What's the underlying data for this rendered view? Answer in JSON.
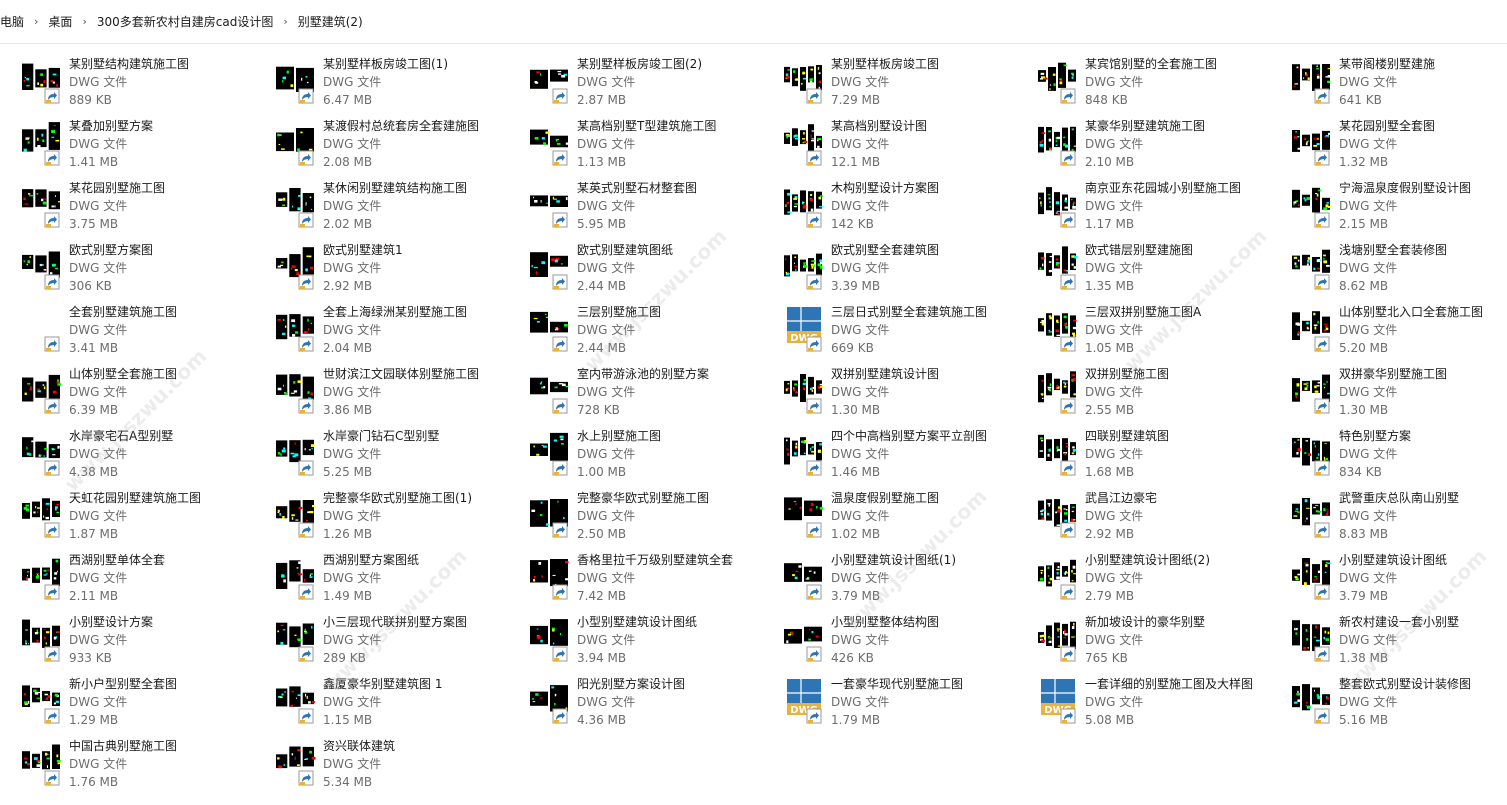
{
  "breadcrumb": [
    "电脑",
    "桌面",
    "300多套新农村自建房cad设计图",
    "别墅建筑(2)"
  ],
  "icons": {
    "separator": "chevron-right-icon",
    "shortcut": "shortcut-arrow-icon",
    "dwg_logo": "dwg-file-icon",
    "thumbnail": "cad-thumbnail-icon"
  },
  "colors": {
    "cad_black": "#000000",
    "cad_green": "#00ff00",
    "cad_cyan": "#00ffff",
    "cad_red": "#ff0000",
    "dwg_blue": "#2e75b6",
    "dwg_gold": "#e8b33a"
  },
  "watermark_text": "www.jsszwu.com",
  "files": [
    {
      "name": "某别墅结构建筑施工图",
      "type": "DWG 文件",
      "size": "889 KB",
      "thumb": "cad"
    },
    {
      "name": "某别墅样板房竣工图(1)",
      "type": "DWG 文件",
      "size": "6.47 MB",
      "thumb": "cad"
    },
    {
      "name": "某别墅样板房竣工图(2)",
      "type": "DWG 文件",
      "size": "2.87 MB",
      "thumb": "cad"
    },
    {
      "name": "某别墅样板房竣工图",
      "type": "DWG 文件",
      "size": "7.29 MB",
      "thumb": "cad"
    },
    {
      "name": "某宾馆别墅的全套施工图",
      "type": "DWG 文件",
      "size": "848 KB",
      "thumb": "cad"
    },
    {
      "name": "某带阁楼别墅建施",
      "type": "DWG 文件",
      "size": "641 KB",
      "thumb": "cad"
    },
    {
      "name": "某叠加别墅方案",
      "type": "DWG 文件",
      "size": "1.41 MB",
      "thumb": "cad"
    },
    {
      "name": "某渡假村总统套房全套建施图",
      "type": "DWG 文件",
      "size": "2.08 MB",
      "thumb": "cad"
    },
    {
      "name": "某高档别墅T型建筑施工图",
      "type": "DWG 文件",
      "size": "1.13 MB",
      "thumb": "cad"
    },
    {
      "name": "某高档别墅设计图",
      "type": "DWG 文件",
      "size": "12.1 MB",
      "thumb": "cad"
    },
    {
      "name": "某豪华别墅建筑施工图",
      "type": "DWG 文件",
      "size": "2.10 MB",
      "thumb": "cad"
    },
    {
      "name": "某花园别墅全套图",
      "type": "DWG 文件",
      "size": "1.32 MB",
      "thumb": "cad"
    },
    {
      "name": "某花园别墅施工图",
      "type": "DWG 文件",
      "size": "3.75 MB",
      "thumb": "cad"
    },
    {
      "name": "某休闲别墅建筑结构施工图",
      "type": "DWG 文件",
      "size": "2.02 MB",
      "thumb": "cad"
    },
    {
      "name": "某英式别墅石材整套图",
      "type": "DWG 文件",
      "size": "5.95 MB",
      "thumb": "cad"
    },
    {
      "name": "木构别墅设计方案图",
      "type": "DWG 文件",
      "size": "142 KB",
      "thumb": "cad"
    },
    {
      "name": "南京亚东花园城小别墅施工图",
      "type": "DWG 文件",
      "size": "1.17 MB",
      "thumb": "cad"
    },
    {
      "name": "宁海温泉度假别墅设计图",
      "type": "DWG 文件",
      "size": "2.15 MB",
      "thumb": "cad"
    },
    {
      "name": "欧式别墅方案图",
      "type": "DWG 文件",
      "size": "306 KB",
      "thumb": "cad"
    },
    {
      "name": "欧式别墅建筑1",
      "type": "DWG 文件",
      "size": "2.92 MB",
      "thumb": "cad"
    },
    {
      "name": "欧式别墅建筑图纸",
      "type": "DWG 文件",
      "size": "2.44 MB",
      "thumb": "cad"
    },
    {
      "name": "欧式别墅全套建筑图",
      "type": "DWG 文件",
      "size": "3.39 MB",
      "thumb": "cad"
    },
    {
      "name": "欧式错层别墅建施图",
      "type": "DWG 文件",
      "size": "1.35 MB",
      "thumb": "cad"
    },
    {
      "name": "浅塘别墅全套装修图",
      "type": "DWG 文件",
      "size": "8.62 MB",
      "thumb": "cad"
    },
    {
      "name": "全套别墅建筑施工图",
      "type": "DWG 文件",
      "size": "3.41 MB",
      "thumb": "none"
    },
    {
      "name": "全套上海绿洲某别墅施工图",
      "type": "DWG 文件",
      "size": "2.04 MB",
      "thumb": "cad"
    },
    {
      "name": "三层别墅施工图",
      "type": "DWG 文件",
      "size": "2.44 MB",
      "thumb": "cad"
    },
    {
      "name": "三层日式别墅全套建筑施工图",
      "type": "DWG 文件",
      "size": "669 KB",
      "thumb": "dwg"
    },
    {
      "name": "三层双拼别墅施工图A",
      "type": "DWG 文件",
      "size": "1.05 MB",
      "thumb": "cad"
    },
    {
      "name": "山体别墅北入口全套施工图",
      "type": "DWG 文件",
      "size": "5.20 MB",
      "thumb": "cad"
    },
    {
      "name": "山体别墅全套施工图",
      "type": "DWG 文件",
      "size": "6.39 MB",
      "thumb": "cad"
    },
    {
      "name": "世财滨江文园联体别墅施工图",
      "type": "DWG 文件",
      "size": "3.86 MB",
      "thumb": "cad"
    },
    {
      "name": "室内带游泳池的别墅方案",
      "type": "DWG 文件",
      "size": "728 KB",
      "thumb": "cad"
    },
    {
      "name": "双拼别墅建筑设计图",
      "type": "DWG 文件",
      "size": "1.30 MB",
      "thumb": "cad"
    },
    {
      "name": "双拼别墅施工图",
      "type": "DWG 文件",
      "size": "2.55 MB",
      "thumb": "cad"
    },
    {
      "name": "双拼豪华别墅施工图",
      "type": "DWG 文件",
      "size": "1.30 MB",
      "thumb": "cad"
    },
    {
      "name": "水岸豪宅石A型别墅",
      "type": "DWG 文件",
      "size": "4.38 MB",
      "thumb": "cad"
    },
    {
      "name": "水岸豪门钻石C型别墅",
      "type": "DWG 文件",
      "size": "5.25 MB",
      "thumb": "cad"
    },
    {
      "name": "水上别墅施工图",
      "type": "DWG 文件",
      "size": "1.00 MB",
      "thumb": "cad"
    },
    {
      "name": "四个中高档别墅方案平立剖图",
      "type": "DWG 文件",
      "size": "1.46 MB",
      "thumb": "cad"
    },
    {
      "name": "四联别墅建筑图",
      "type": "DWG 文件",
      "size": "1.68 MB",
      "thumb": "cad"
    },
    {
      "name": "特色别墅方案",
      "type": "DWG 文件",
      "size": "834 KB",
      "thumb": "cad"
    },
    {
      "name": "天虹花园别墅建筑施工图",
      "type": "DWG 文件",
      "size": "1.87 MB",
      "thumb": "cad"
    },
    {
      "name": "完整豪华欧式别墅施工图(1)",
      "type": "DWG 文件",
      "size": "1.26 MB",
      "thumb": "cad"
    },
    {
      "name": "完整豪华欧式别墅施工图",
      "type": "DWG 文件",
      "size": "2.50 MB",
      "thumb": "cad"
    },
    {
      "name": "温泉度假别墅施工图",
      "type": "DWG 文件",
      "size": "1.02 MB",
      "thumb": "cad"
    },
    {
      "name": "武昌江边豪宅",
      "type": "DWG 文件",
      "size": "2.92 MB",
      "thumb": "cad"
    },
    {
      "name": "武警重庆总队南山别墅",
      "type": "DWG 文件",
      "size": "8.83 MB",
      "thumb": "cad"
    },
    {
      "name": "西湖别墅单体全套",
      "type": "DWG 文件",
      "size": "2.11 MB",
      "thumb": "cad"
    },
    {
      "name": "西湖别墅方案图纸",
      "type": "DWG 文件",
      "size": "1.49 MB",
      "thumb": "cad"
    },
    {
      "name": "香格里拉千万级别墅建筑全套",
      "type": "DWG 文件",
      "size": "7.42 MB",
      "thumb": "cad"
    },
    {
      "name": "小别墅建筑设计图纸(1)",
      "type": "DWG 文件",
      "size": "3.79 MB",
      "thumb": "cad"
    },
    {
      "name": "小别墅建筑设计图纸(2)",
      "type": "DWG 文件",
      "size": "2.79 MB",
      "thumb": "cad"
    },
    {
      "name": "小别墅建筑设计图纸",
      "type": "DWG 文件",
      "size": "3.79 MB",
      "thumb": "cad"
    },
    {
      "name": "小别墅设计方案",
      "type": "DWG 文件",
      "size": "933 KB",
      "thumb": "cad"
    },
    {
      "name": "小三层现代联拼别墅方案图",
      "type": "DWG 文件",
      "size": "289 KB",
      "thumb": "cad"
    },
    {
      "name": "小型别墅建筑设计图纸",
      "type": "DWG 文件",
      "size": "3.94 MB",
      "thumb": "cad"
    },
    {
      "name": "小型别墅整体结构图",
      "type": "DWG 文件",
      "size": "426 KB",
      "thumb": "cad"
    },
    {
      "name": "新加坡设计的豪华别墅",
      "type": "DWG 文件",
      "size": "765 KB",
      "thumb": "cad"
    },
    {
      "name": "新农村建设一套小别墅",
      "type": "DWG 文件",
      "size": "1.38 MB",
      "thumb": "cad"
    },
    {
      "name": "新小户型别墅全套图",
      "type": "DWG 文件",
      "size": "1.29 MB",
      "thumb": "cad"
    },
    {
      "name": "鑫厦豪华别墅建筑图 1",
      "type": "DWG 文件",
      "size": "1.15 MB",
      "thumb": "cad"
    },
    {
      "name": "阳光别墅方案设计图",
      "type": "DWG 文件",
      "size": "4.36 MB",
      "thumb": "cad"
    },
    {
      "name": "一套豪华现代别墅施工图",
      "type": "DWG 文件",
      "size": "1.79 MB",
      "thumb": "dwg"
    },
    {
      "name": "一套详细的别墅施工图及大样图",
      "type": "DWG 文件",
      "size": "5.08 MB",
      "thumb": "dwg"
    },
    {
      "name": "整套欧式别墅设计装修图",
      "type": "DWG 文件",
      "size": "5.16 MB",
      "thumb": "cad"
    },
    {
      "name": "中国古典别墅施工图",
      "type": "DWG 文件",
      "size": "1.76 MB",
      "thumb": "cad"
    },
    {
      "name": "资兴联体建筑",
      "type": "DWG 文件",
      "size": "5.34 MB",
      "thumb": "cad"
    }
  ]
}
